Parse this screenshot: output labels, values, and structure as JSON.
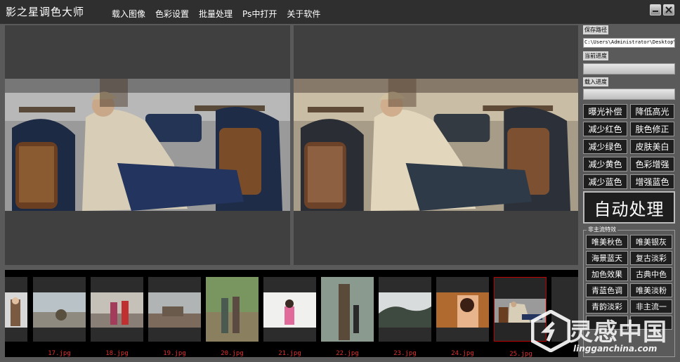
{
  "app": {
    "title": "影之星调色大师"
  },
  "menu": [
    {
      "label": "载入图像"
    },
    {
      "label": "色彩设置"
    },
    {
      "label": "批量处理"
    },
    {
      "label": "Ps中打开"
    },
    {
      "label": "关于软件"
    }
  ],
  "side": {
    "save_path_label": "保存路径",
    "save_path_value": "C:\\Users\\Administrator\\Desktop\\",
    "current_progress_label": "当前进度",
    "current_progress": 0,
    "load_progress_label": "载入进度",
    "load_progress": 0,
    "adjust_buttons": [
      {
        "label": "曝光补偿"
      },
      {
        "label": "降低高光"
      },
      {
        "label": "减少红色"
      },
      {
        "label": "肤色修正"
      },
      {
        "label": "减少绿色"
      },
      {
        "label": "皮肤美白"
      },
      {
        "label": "减少黄色"
      },
      {
        "label": "色彩增强"
      },
      {
        "label": "减少蓝色"
      },
      {
        "label": "增强蓝色"
      }
    ],
    "auto_button": "自动处理",
    "preset_title": "非主流特效",
    "preset_buttons": [
      {
        "label": "唯美秋色"
      },
      {
        "label": "唯美银灰"
      },
      {
        "label": "海景蓝天"
      },
      {
        "label": "复古淡彩"
      },
      {
        "label": "加色效果"
      },
      {
        "label": "古典中色"
      },
      {
        "label": "青蓝色调"
      },
      {
        "label": "唯美淡粉"
      },
      {
        "label": "青韵淡彩"
      },
      {
        "label": "非主流一"
      },
      {
        "label": ""
      },
      {
        "label": ""
      }
    ]
  },
  "thumbnails": [
    {
      "label": ""
    },
    {
      "label": "17.jpg"
    },
    {
      "label": "18.jpg"
    },
    {
      "label": "19.jpg"
    },
    {
      "label": "20.jpg"
    },
    {
      "label": "21.jpg"
    },
    {
      "label": "22.jpg"
    },
    {
      "label": "23.jpg"
    },
    {
      "label": "24.jpg"
    },
    {
      "label": "25.jpg"
    }
  ],
  "watermark": {
    "cn": "灵感中国",
    "url": "lingganchina.com"
  },
  "colors": {
    "title_bg": "#2f2f2f",
    "panel_bg": "#404040",
    "thumb_label": "#e03030",
    "accent_selected": "#b00000"
  }
}
